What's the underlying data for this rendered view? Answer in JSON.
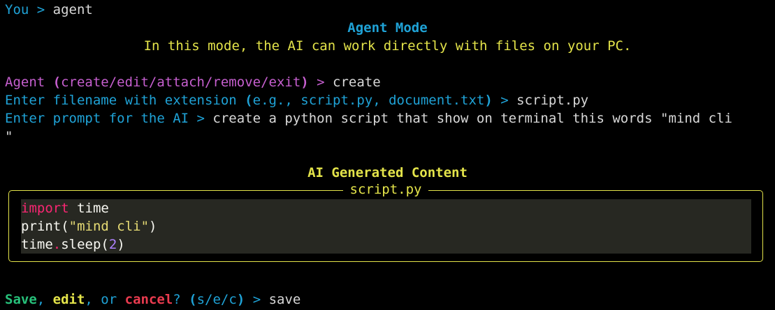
{
  "colors": {
    "background": "#000000",
    "prompt_blue": "#1fa2d6",
    "agent_magenta": "#c65fcf",
    "heading_yellow": "#e4e44a",
    "save_green": "#27c07a",
    "cancel_red": "#ea3b4f",
    "input_white": "#d8d8d8",
    "code_background": "#272822"
  },
  "line1": {
    "prompt": "You > ",
    "input": "agent"
  },
  "header": {
    "title": "Agent Mode",
    "subtitle": "In this mode, the AI can work directly with files on your PC."
  },
  "agent_prompt": {
    "label": "Agent ",
    "open_paren": "(",
    "options": "create/edit/attach/remove/exit",
    "close_paren": ")",
    "arrow": " > ",
    "input": "create"
  },
  "filename_prompt": {
    "label": "Enter filename with extension ",
    "open_paren": "(",
    "examples": "e.g., script.py, document.txt",
    "close_paren": ")",
    "arrow": " > ",
    "input": "script.py"
  },
  "ai_prompt": {
    "label": "Enter prompt for the AI > ",
    "input": "create a python script that show on terminal this words \"mind cli",
    "wrap_continuation": "\""
  },
  "generated": {
    "heading": "AI Generated Content",
    "file_title": "script.py",
    "code_lines": [
      {
        "t1": "import",
        "t2": " time"
      },
      {
        "t1": "print(",
        "t2": "\"mind cli\"",
        "t3": ")"
      },
      {
        "t1": "time",
        "t2": ".",
        "t3": "sleep(",
        "t4": "2",
        "t5": ")"
      }
    ]
  },
  "save_prompt": {
    "save": "Save",
    "comma1": ", ",
    "edit": "edit",
    "comma2": ", or ",
    "cancel": "cancel",
    "question": "? ",
    "open_paren": "(",
    "keys": "s/e/c",
    "close_paren": ")",
    "arrow": " > ",
    "input": "save"
  }
}
